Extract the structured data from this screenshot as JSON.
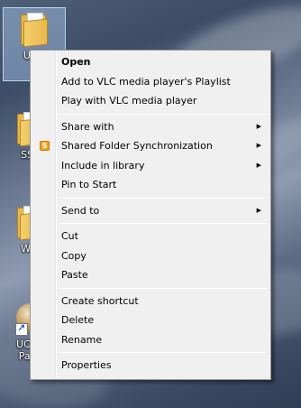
{
  "desktop": {
    "icons": [
      {
        "label": "UCG"
      },
      {
        "label": "SS ("
      },
      {
        "label": "Wor"
      },
      {
        "label_line1": "UCG (",
        "label_line2": "Pane"
      }
    ]
  },
  "context_menu": {
    "groups": [
      [
        {
          "label": "Open",
          "bold": true
        },
        {
          "label": "Add to VLC media player's Playlist"
        },
        {
          "label": "Play with VLC media player"
        }
      ],
      [
        {
          "label": "Share with",
          "submenu": true
        },
        {
          "label": "Shared Folder Synchronization",
          "submenu": true,
          "icon": "sync-folder-icon"
        },
        {
          "label": "Include in library",
          "submenu": true
        },
        {
          "label": "Pin to Start"
        }
      ],
      [
        {
          "label": "Send to",
          "submenu": true
        }
      ],
      [
        {
          "label": "Cut"
        },
        {
          "label": "Copy"
        },
        {
          "label": "Paste"
        }
      ],
      [
        {
          "label": "Create shortcut"
        },
        {
          "label": "Delete"
        },
        {
          "label": "Rename"
        }
      ],
      [
        {
          "label": "Properties"
        }
      ]
    ],
    "submenu_glyph": "▶"
  }
}
